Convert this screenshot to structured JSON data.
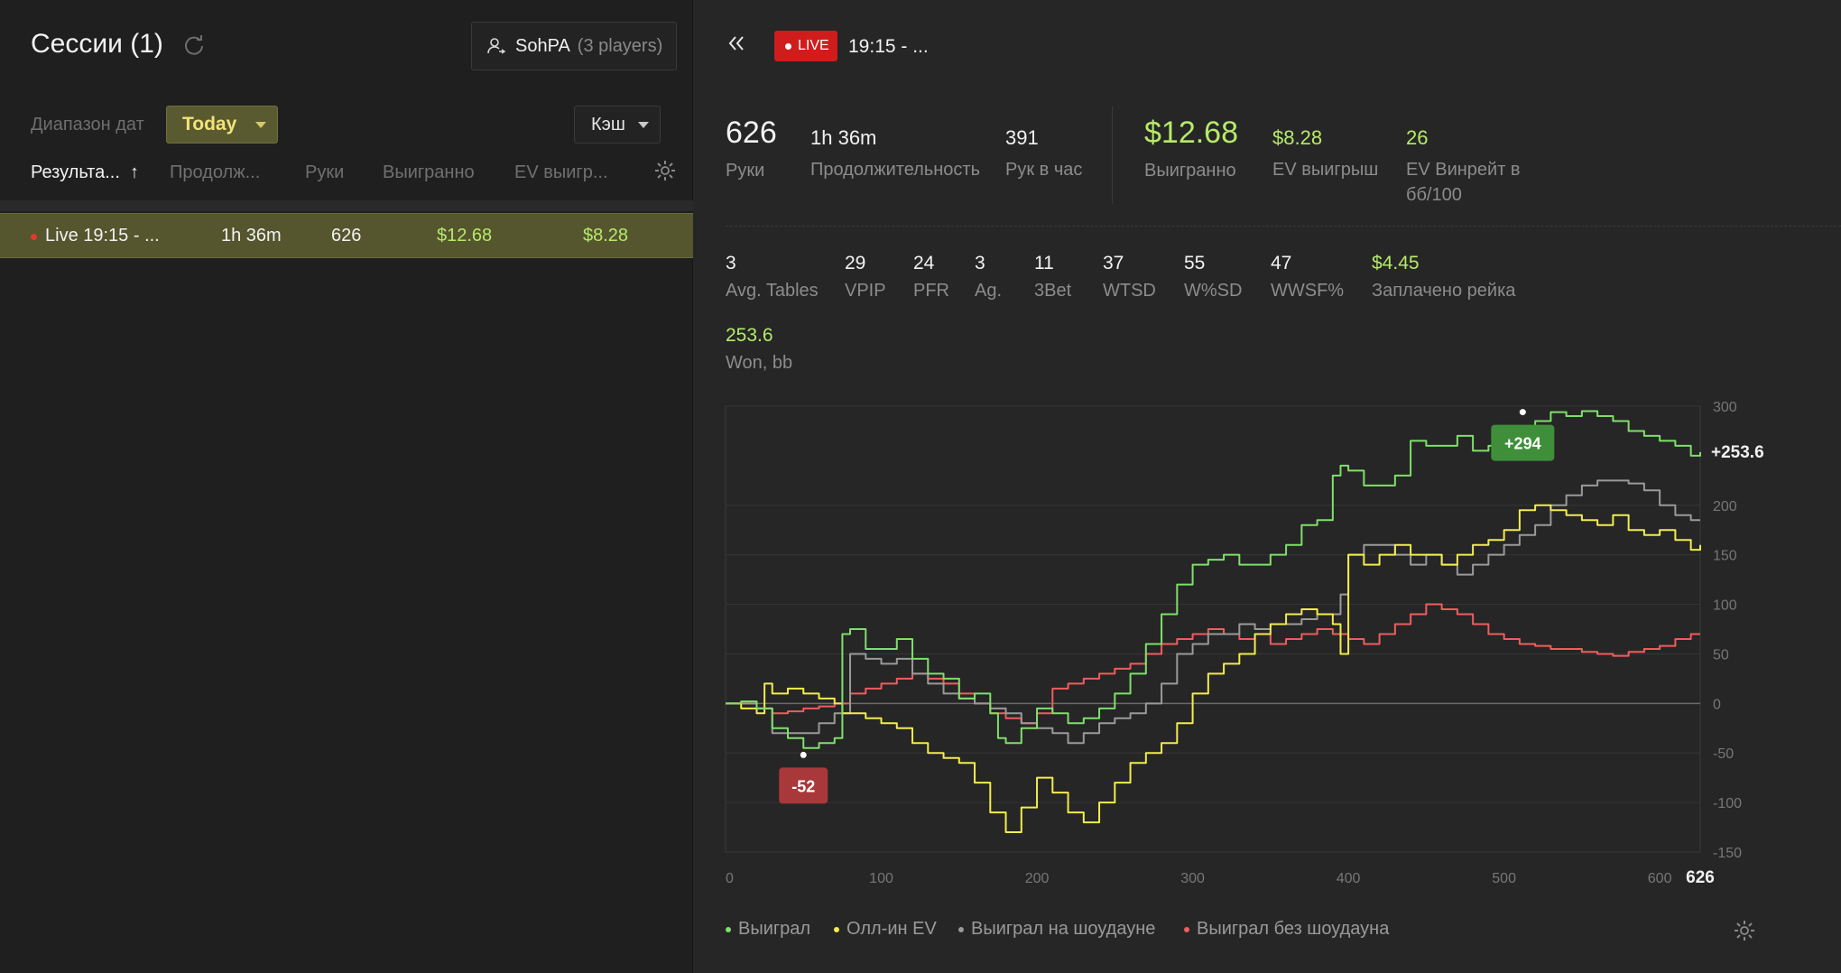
{
  "left": {
    "title": "Сессии (1)",
    "player_filter": {
      "name": "SohPA",
      "count": "(3 players)"
    },
    "date_range_label": "Диапазон дат",
    "date_range_value": "Today",
    "game_type": "Кэш",
    "columns": [
      "Результа...",
      "Продолж...",
      "Руки",
      "Выигранно",
      "EV выигр..."
    ],
    "sort_arrow": "↑",
    "sessions": [
      {
        "name": "Live 19:15 - ...",
        "duration": "1h 36m",
        "hands": "626",
        "won": "$12.68",
        "ev_won": "$8.28"
      }
    ]
  },
  "right": {
    "live_badge": "LIVE",
    "session_title": "19:15 - ...",
    "stats_top": [
      {
        "value": "626",
        "label": "Руки"
      },
      {
        "value": "1h 36m",
        "label": "Продолжительность"
      },
      {
        "value": "391",
        "label": "Рук в час"
      },
      {
        "value": "$12.68",
        "label": "Выигранно"
      },
      {
        "value": "$8.28",
        "label": "EV выигрыш"
      },
      {
        "value": "26",
        "label": "EV Винрейт в",
        "label2": "бб/100"
      }
    ],
    "stats_bottom": [
      {
        "value": "3",
        "label": "Avg. Tables"
      },
      {
        "value": "29",
        "label": "VPIP"
      },
      {
        "value": "24",
        "label": "PFR"
      },
      {
        "value": "3",
        "label": "Ag."
      },
      {
        "value": "11",
        "label": "3Bet"
      },
      {
        "value": "37",
        "label": "WTSD"
      },
      {
        "value": "55",
        "label": "W%SD"
      },
      {
        "value": "47",
        "label": "WWSF%"
      },
      {
        "value": "$4.45",
        "label": "Заплачено рейка"
      }
    ],
    "won_bb": {
      "value": "253.6",
      "label": "Won, bb"
    },
    "legend": [
      "Выиграл",
      "Олл-ин EV",
      "Выиграл на шоудауне",
      "Выиграл без шоудауна"
    ],
    "colors": {
      "won": "#7ee06a",
      "allin_ev": "#f2ec4e",
      "showdown": "#9a9a9a",
      "no_showdown": "#ef5d5d",
      "accent": "#b6ea6a",
      "live": "#d11c1c"
    }
  },
  "chart_data": {
    "type": "line",
    "x_ticks": [
      0,
      100,
      200,
      300,
      400,
      500,
      600
    ],
    "x_end_label": "626",
    "y_ticks": [
      300,
      200,
      150,
      100,
      50,
      0,
      -50,
      -100,
      -150
    ],
    "xlim": [
      0,
      626
    ],
    "ylim": [
      -150,
      300
    ],
    "grid": true,
    "legend_position": "bottom",
    "annotations": [
      {
        "label": "+294",
        "x": 512,
        "y": 294
      },
      {
        "label": "-52",
        "x": 50,
        "y": -52
      }
    ],
    "end_label": "+253.6",
    "series": [
      {
        "name": "Выиграл",
        "color": "#7ee06a",
        "x": [
          0,
          10,
          20,
          30,
          40,
          50,
          60,
          70,
          75,
          80,
          90,
          100,
          110,
          120,
          130,
          140,
          150,
          160,
          170,
          175,
          180,
          190,
          200,
          210,
          220,
          230,
          240,
          250,
          260,
          270,
          280,
          290,
          300,
          310,
          320,
          330,
          340,
          350,
          360,
          370,
          380,
          390,
          395,
          400,
          410,
          420,
          430,
          440,
          450,
          460,
          470,
          480,
          490,
          500,
          510,
          520,
          530,
          540,
          550,
          560,
          570,
          580,
          590,
          600,
          610,
          620,
          626
        ],
        "y": [
          0,
          2,
          -5,
          -25,
          -35,
          -45,
          -40,
          -35,
          70,
          75,
          55,
          55,
          65,
          45,
          30,
          25,
          5,
          10,
          -10,
          -35,
          -40,
          -25,
          -5,
          -10,
          -20,
          -15,
          -5,
          10,
          30,
          60,
          90,
          120,
          140,
          145,
          150,
          140,
          140,
          150,
          160,
          180,
          185,
          230,
          240,
          235,
          220,
          220,
          230,
          265,
          260,
          260,
          270,
          255,
          260,
          270,
          280,
          285,
          294,
          290,
          295,
          290,
          285,
          275,
          270,
          265,
          260,
          250,
          253.6
        ]
      },
      {
        "name": "Олл-ин EV",
        "color": "#f2ec4e",
        "x": [
          0,
          10,
          20,
          25,
          30,
          40,
          50,
          60,
          70,
          75,
          80,
          90,
          100,
          110,
          120,
          130,
          140,
          150,
          160,
          170,
          180,
          190,
          200,
          210,
          220,
          230,
          240,
          250,
          260,
          270,
          280,
          290,
          300,
          310,
          320,
          330,
          340,
          350,
          360,
          370,
          380,
          390,
          395,
          400,
          410,
          420,
          430,
          440,
          450,
          460,
          470,
          480,
          490,
          500,
          510,
          520,
          530,
          540,
          550,
          560,
          570,
          580,
          590,
          600,
          610,
          620,
          626
        ],
        "y": [
          0,
          -5,
          -10,
          20,
          10,
          15,
          10,
          5,
          0,
          -10,
          -10,
          -15,
          -20,
          -25,
          -40,
          -50,
          -55,
          -60,
          -80,
          -110,
          -130,
          -105,
          -75,
          -90,
          -110,
          -120,
          -100,
          -80,
          -60,
          -50,
          -40,
          -20,
          10,
          30,
          40,
          50,
          70,
          80,
          90,
          95,
          90,
          80,
          50,
          150,
          140,
          150,
          160,
          150,
          150,
          140,
          150,
          160,
          165,
          175,
          195,
          200,
          195,
          190,
          185,
          180,
          190,
          175,
          170,
          175,
          165,
          155,
          160
        ]
      },
      {
        "name": "Выиграл на шоудауне",
        "color": "#9a9a9a",
        "x": [
          0,
          20,
          30,
          50,
          60,
          70,
          80,
          90,
          100,
          110,
          120,
          130,
          140,
          150,
          160,
          170,
          180,
          190,
          200,
          210,
          220,
          230,
          240,
          250,
          260,
          270,
          280,
          290,
          300,
          310,
          320,
          330,
          340,
          350,
          360,
          370,
          380,
          390,
          395,
          400,
          410,
          420,
          430,
          440,
          450,
          460,
          470,
          480,
          490,
          500,
          510,
          520,
          530,
          540,
          550,
          560,
          570,
          580,
          590,
          600,
          610,
          620,
          626
        ],
        "y": [
          0,
          -5,
          -30,
          -30,
          -20,
          -10,
          50,
          45,
          40,
          45,
          30,
          20,
          10,
          5,
          0,
          -5,
          -10,
          -20,
          -25,
          -30,
          -40,
          -30,
          -20,
          -15,
          -10,
          0,
          20,
          50,
          60,
          70,
          70,
          80,
          75,
          80,
          80,
          85,
          90,
          90,
          110,
          150,
          160,
          160,
          150,
          140,
          150,
          140,
          130,
          140,
          150,
          160,
          170,
          180,
          200,
          210,
          220,
          225,
          225,
          222,
          215,
          200,
          190,
          185,
          185
        ]
      },
      {
        "name": "Выиграл без шоудауна",
        "color": "#ef5d5d",
        "x": [
          0,
          20,
          30,
          40,
          50,
          60,
          70,
          80,
          90,
          100,
          110,
          120,
          130,
          140,
          150,
          160,
          170,
          180,
          190,
          200,
          210,
          220,
          230,
          240,
          250,
          260,
          270,
          280,
          290,
          300,
          310,
          320,
          330,
          340,
          350,
          360,
          370,
          380,
          390,
          400,
          410,
          420,
          430,
          440,
          450,
          460,
          470,
          480,
          490,
          500,
          510,
          520,
          530,
          540,
          550,
          560,
          570,
          580,
          590,
          600,
          610,
          620,
          626
        ],
        "y": [
          0,
          -5,
          -10,
          -8,
          -5,
          -3,
          0,
          10,
          15,
          20,
          25,
          30,
          25,
          20,
          10,
          0,
          -10,
          -15,
          -20,
          -10,
          15,
          20,
          25,
          30,
          35,
          40,
          50,
          60,
          65,
          70,
          75,
          70,
          65,
          70,
          60,
          65,
          70,
          75,
          70,
          65,
          60,
          70,
          80,
          90,
          100,
          95,
          90,
          80,
          70,
          65,
          60,
          58,
          55,
          55,
          52,
          50,
          48,
          52,
          55,
          58,
          65,
          70,
          70
        ]
      }
    ]
  }
}
